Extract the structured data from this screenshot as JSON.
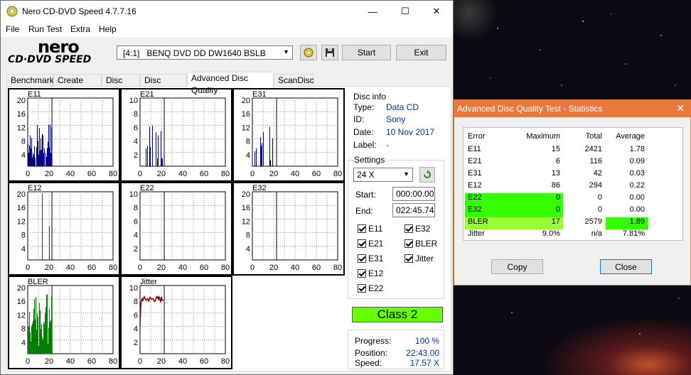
{
  "desktop": {
    "background": "starfield"
  },
  "app": {
    "title": "Nero CD-DVD Speed 4.7.7.16",
    "logo_text_1": "nero",
    "logo_text_2": "CD·DVD SPEED",
    "menu": [
      "File",
      "Run Test",
      "Extra",
      "Help"
    ],
    "drive": "[4:1]   BENQ DVD DD DW1640 BSLB",
    "start_label": "Start",
    "exit_label": "Exit",
    "tabs": [
      "Benchmark",
      "Create Disc",
      "Disc Info",
      "Disc Quality",
      "Advanced Disc Quality",
      "ScanDisc"
    ],
    "active_tab": "Advanced Disc Quality"
  },
  "charts": [
    {
      "label": "E11",
      "ymax_labels": [
        "20",
        "16",
        "12",
        "8",
        "4"
      ],
      "x_labels": [
        "0",
        "20",
        "40",
        "60",
        "80"
      ],
      "color": "#00008b",
      "kind": "bars",
      "scale": 20
    },
    {
      "label": "E21",
      "ymax_labels": [
        "10",
        "8",
        "6",
        "4",
        "2"
      ],
      "x_labels": [
        "0",
        "20",
        "40",
        "60",
        "80"
      ],
      "color": "#00008b",
      "kind": "bars",
      "scale": 10
    },
    {
      "label": "E31",
      "ymax_labels": [
        "20",
        "16",
        "12",
        "8",
        "4"
      ],
      "x_labels": [
        "0",
        "20",
        "40",
        "60",
        "80"
      ],
      "color": "#00008b",
      "kind": "bars",
      "scale": 20
    },
    {
      "label": "E12",
      "ymax_labels": [
        "20",
        "16",
        "12",
        "8",
        "4"
      ],
      "x_labels": [
        "0",
        "20",
        "40",
        "60",
        "80"
      ],
      "color": "#800080",
      "kind": "bars",
      "scale": 20
    },
    {
      "label": "E22",
      "ymax_labels": [
        "10",
        "8",
        "6",
        "4",
        "2"
      ],
      "x_labels": [
        "0",
        "20",
        "40",
        "60",
        "80"
      ],
      "color": "#800080",
      "kind": "none",
      "scale": 10
    },
    {
      "label": "E32",
      "ymax_labels": [
        "20",
        "16",
        "12",
        "8",
        "4"
      ],
      "x_labels": [
        "0",
        "20",
        "40",
        "60",
        "80"
      ],
      "color": "#800080",
      "kind": "none",
      "scale": 20
    },
    {
      "label": "BLER",
      "ymax_labels": [
        "20",
        "16",
        "12",
        "8",
        "4"
      ],
      "x_labels": [
        "0",
        "20",
        "40",
        "60",
        "80"
      ],
      "color": "#008000",
      "kind": "bars",
      "scale": 20
    },
    {
      "label": "Jitter",
      "ymax_labels": [
        "10",
        "8",
        "6",
        "4",
        "2"
      ],
      "x_labels": [
        "0",
        "20",
        "40",
        "60",
        "80"
      ],
      "color": "#800000",
      "kind": "line",
      "scale": 10
    }
  ],
  "disc_info": {
    "title": "Disc info",
    "type_label": "Type:",
    "type": "Data CD",
    "id_label": "ID:",
    "id": "Sony",
    "date_label": "Date:",
    "date": "10 Nov 2017",
    "label_label": "Label:",
    "label": "-"
  },
  "settings": {
    "title": "Settings",
    "speed": "24 X",
    "start_label": "Start:",
    "start": "000:00.00",
    "end_label": "End:",
    "end": "022:45.74",
    "checks_left": [
      "E11",
      "E21",
      "E31",
      "E12",
      "E22"
    ],
    "checks_right": [
      "E32",
      "BLER",
      "Jitter"
    ]
  },
  "class": "Class 2",
  "progress": {
    "progress_label": "Progress:",
    "progress": "100 %",
    "position_label": "Position:",
    "position": "22:43.00",
    "speed_label": "Speed:",
    "speed": "17.57 X"
  },
  "stats": {
    "title": "Advanced Disc Quality Test - Statistics",
    "headers": [
      "Error",
      "Maximum",
      "Total",
      "Average"
    ],
    "rows": [
      {
        "name": "E11",
        "max": "15",
        "total": "2421",
        "avg": "1.78"
      },
      {
        "name": "E21",
        "max": "6",
        "total": "116",
        "avg": "0.09"
      },
      {
        "name": "E31",
        "max": "13",
        "total": "42",
        "avg": "0.03"
      },
      {
        "name": "E12",
        "max": "86",
        "total": "294",
        "avg": "0.22"
      },
      {
        "name": "E22",
        "max": "0",
        "total": "0",
        "avg": "0.00"
      },
      {
        "name": "E32",
        "max": "0",
        "total": "0",
        "avg": "0.00"
      },
      {
        "name": "BLER",
        "max": "17",
        "total": "2579",
        "avg": "1.89"
      },
      {
        "name": "Jitter",
        "max": "9.0%",
        "total": "n/a",
        "avg": "7.81%"
      }
    ],
    "copy_label": "Copy",
    "close_label": "Close"
  }
}
